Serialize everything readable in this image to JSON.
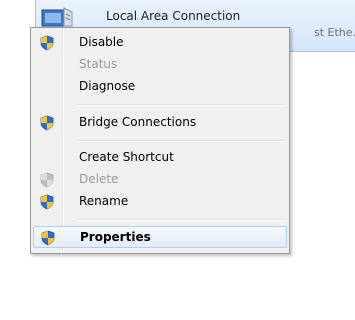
{
  "adapter": {
    "title": "Local Area Connection",
    "device_truncated": "st Ethe..."
  },
  "menu": {
    "items": [
      {
        "label": "Disable",
        "icon": "shield-icon",
        "enabled": true
      },
      {
        "label": "Status",
        "icon": "",
        "enabled": false
      },
      {
        "label": "Diagnose",
        "icon": "",
        "enabled": true
      },
      {
        "label": "Bridge Connections",
        "icon": "shield-icon",
        "enabled": true
      },
      {
        "label": "Create Shortcut",
        "icon": "",
        "enabled": true
      },
      {
        "label": "Delete",
        "icon": "shield-icon-disabled",
        "enabled": false
      },
      {
        "label": "Rename",
        "icon": "shield-icon",
        "enabled": true
      },
      {
        "label": "Properties",
        "icon": "shield-icon",
        "enabled": true,
        "default": true,
        "highlighted": true
      }
    ]
  },
  "colors": {
    "selection_border": "#9cc3ec",
    "menu_background": "#f0f0f0",
    "disabled_text": "#9a9a9a",
    "shield_blue": "#2f6fc9",
    "shield_yellow": "#f4c430"
  }
}
